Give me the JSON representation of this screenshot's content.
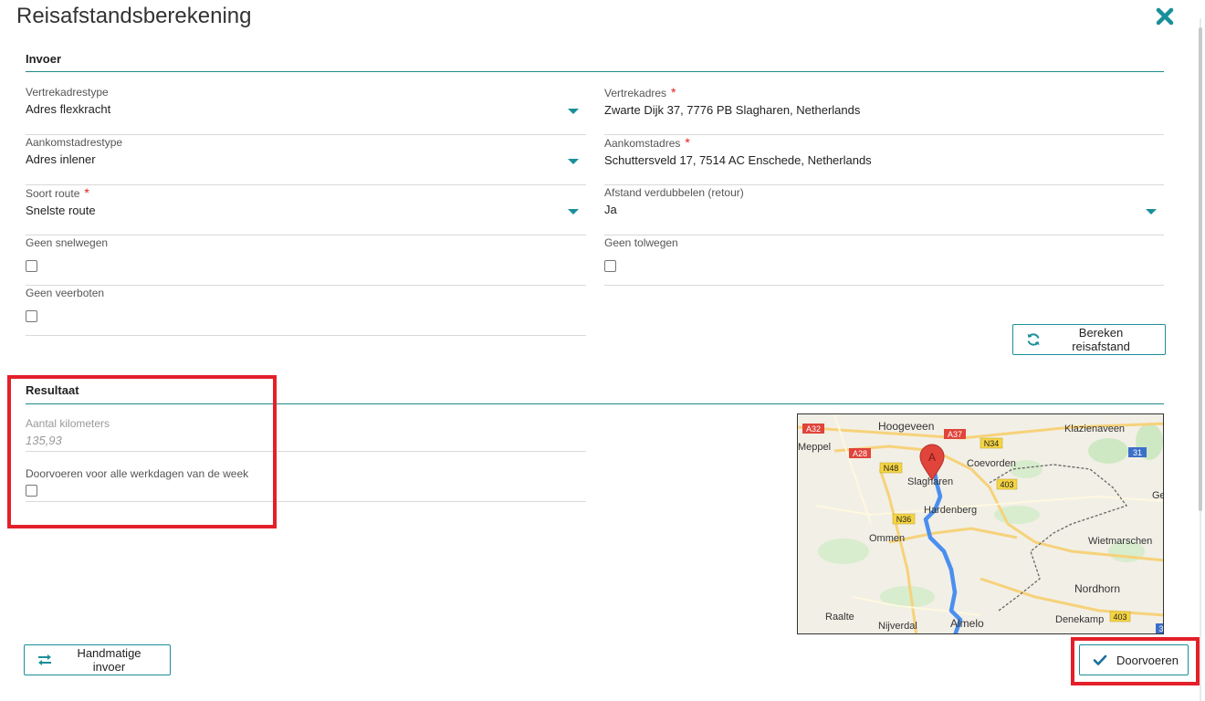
{
  "dialog": {
    "title": "Reisafstandsberekening",
    "close_icon": "close-icon"
  },
  "invoer": {
    "section_title": "Invoer",
    "vertrekadrestype": {
      "label": "Vertrekadrestype",
      "value": "Adres flexkracht"
    },
    "vertrekadres": {
      "label": "Vertrekadres",
      "required": "*",
      "value": "Zwarte Dijk 37, 7776 PB Slagharen, Netherlands"
    },
    "aankomstadrestype": {
      "label": "Aankomstadrestype",
      "value": "Adres inlener"
    },
    "aankomstadres": {
      "label": "Aankomstadres",
      "required": "*",
      "value": "Schuttersveld 17, 7514 AC Enschede, Netherlands"
    },
    "soort_route": {
      "label": "Soort route",
      "required": "*",
      "value": "Snelste route"
    },
    "afstand_verdubbelen": {
      "label": "Afstand verdubbelen (retour)",
      "value": "Ja"
    },
    "geen_snelwegen": {
      "label": "Geen snelwegen",
      "checked": false
    },
    "geen_tolwegen": {
      "label": "Geen tolwegen",
      "checked": false
    },
    "geen_veerboten": {
      "label": "Geen veerboten",
      "checked": false
    },
    "bereken_button": "Bereken reisafstand"
  },
  "resultaat": {
    "section_title": "Resultaat",
    "aantal_km": {
      "label": "Aantal kilometers",
      "value": "135,93"
    },
    "doorvoeren_week": {
      "label": "Doorvoeren voor alle werkdagen van de week",
      "checked": false
    }
  },
  "map": {
    "marker": "A",
    "places": {
      "hoogeveen": "Hoogeveen",
      "klazienaveen": "Klazienaveen",
      "meppel": "Meppel",
      "coevorden": "Coevorden",
      "slagharen": "Slagharen",
      "hardenberg": "Hardenberg",
      "ommen": "Ommen",
      "wietmarschen": "Wietmarschen",
      "nordhorn": "Nordhorn",
      "raalte": "Raalte",
      "nijverdal": "Nijverdal",
      "almelo": "Almelo",
      "denekamp": "Denekamp",
      "ge": "Ge"
    },
    "roads": {
      "a32": "A32",
      "a37": "A37",
      "a28": "A28",
      "n34": "N34",
      "n48": "N48",
      "r403a": "403",
      "r403b": "403",
      "n36": "N36",
      "r31": "31",
      "r3": "3"
    },
    "colors": {
      "route": "#4a8ff0",
      "marker": "#e0443a",
      "road_label": "#f5d442",
      "border": "#666666"
    }
  },
  "footer": {
    "handmatige_button": "Handmatige invoer",
    "doorvoeren_button": "Doorvoeren"
  },
  "colors": {
    "accent": "#1a8f9a",
    "required": "#e0201c",
    "highlight": "#e3202a"
  }
}
